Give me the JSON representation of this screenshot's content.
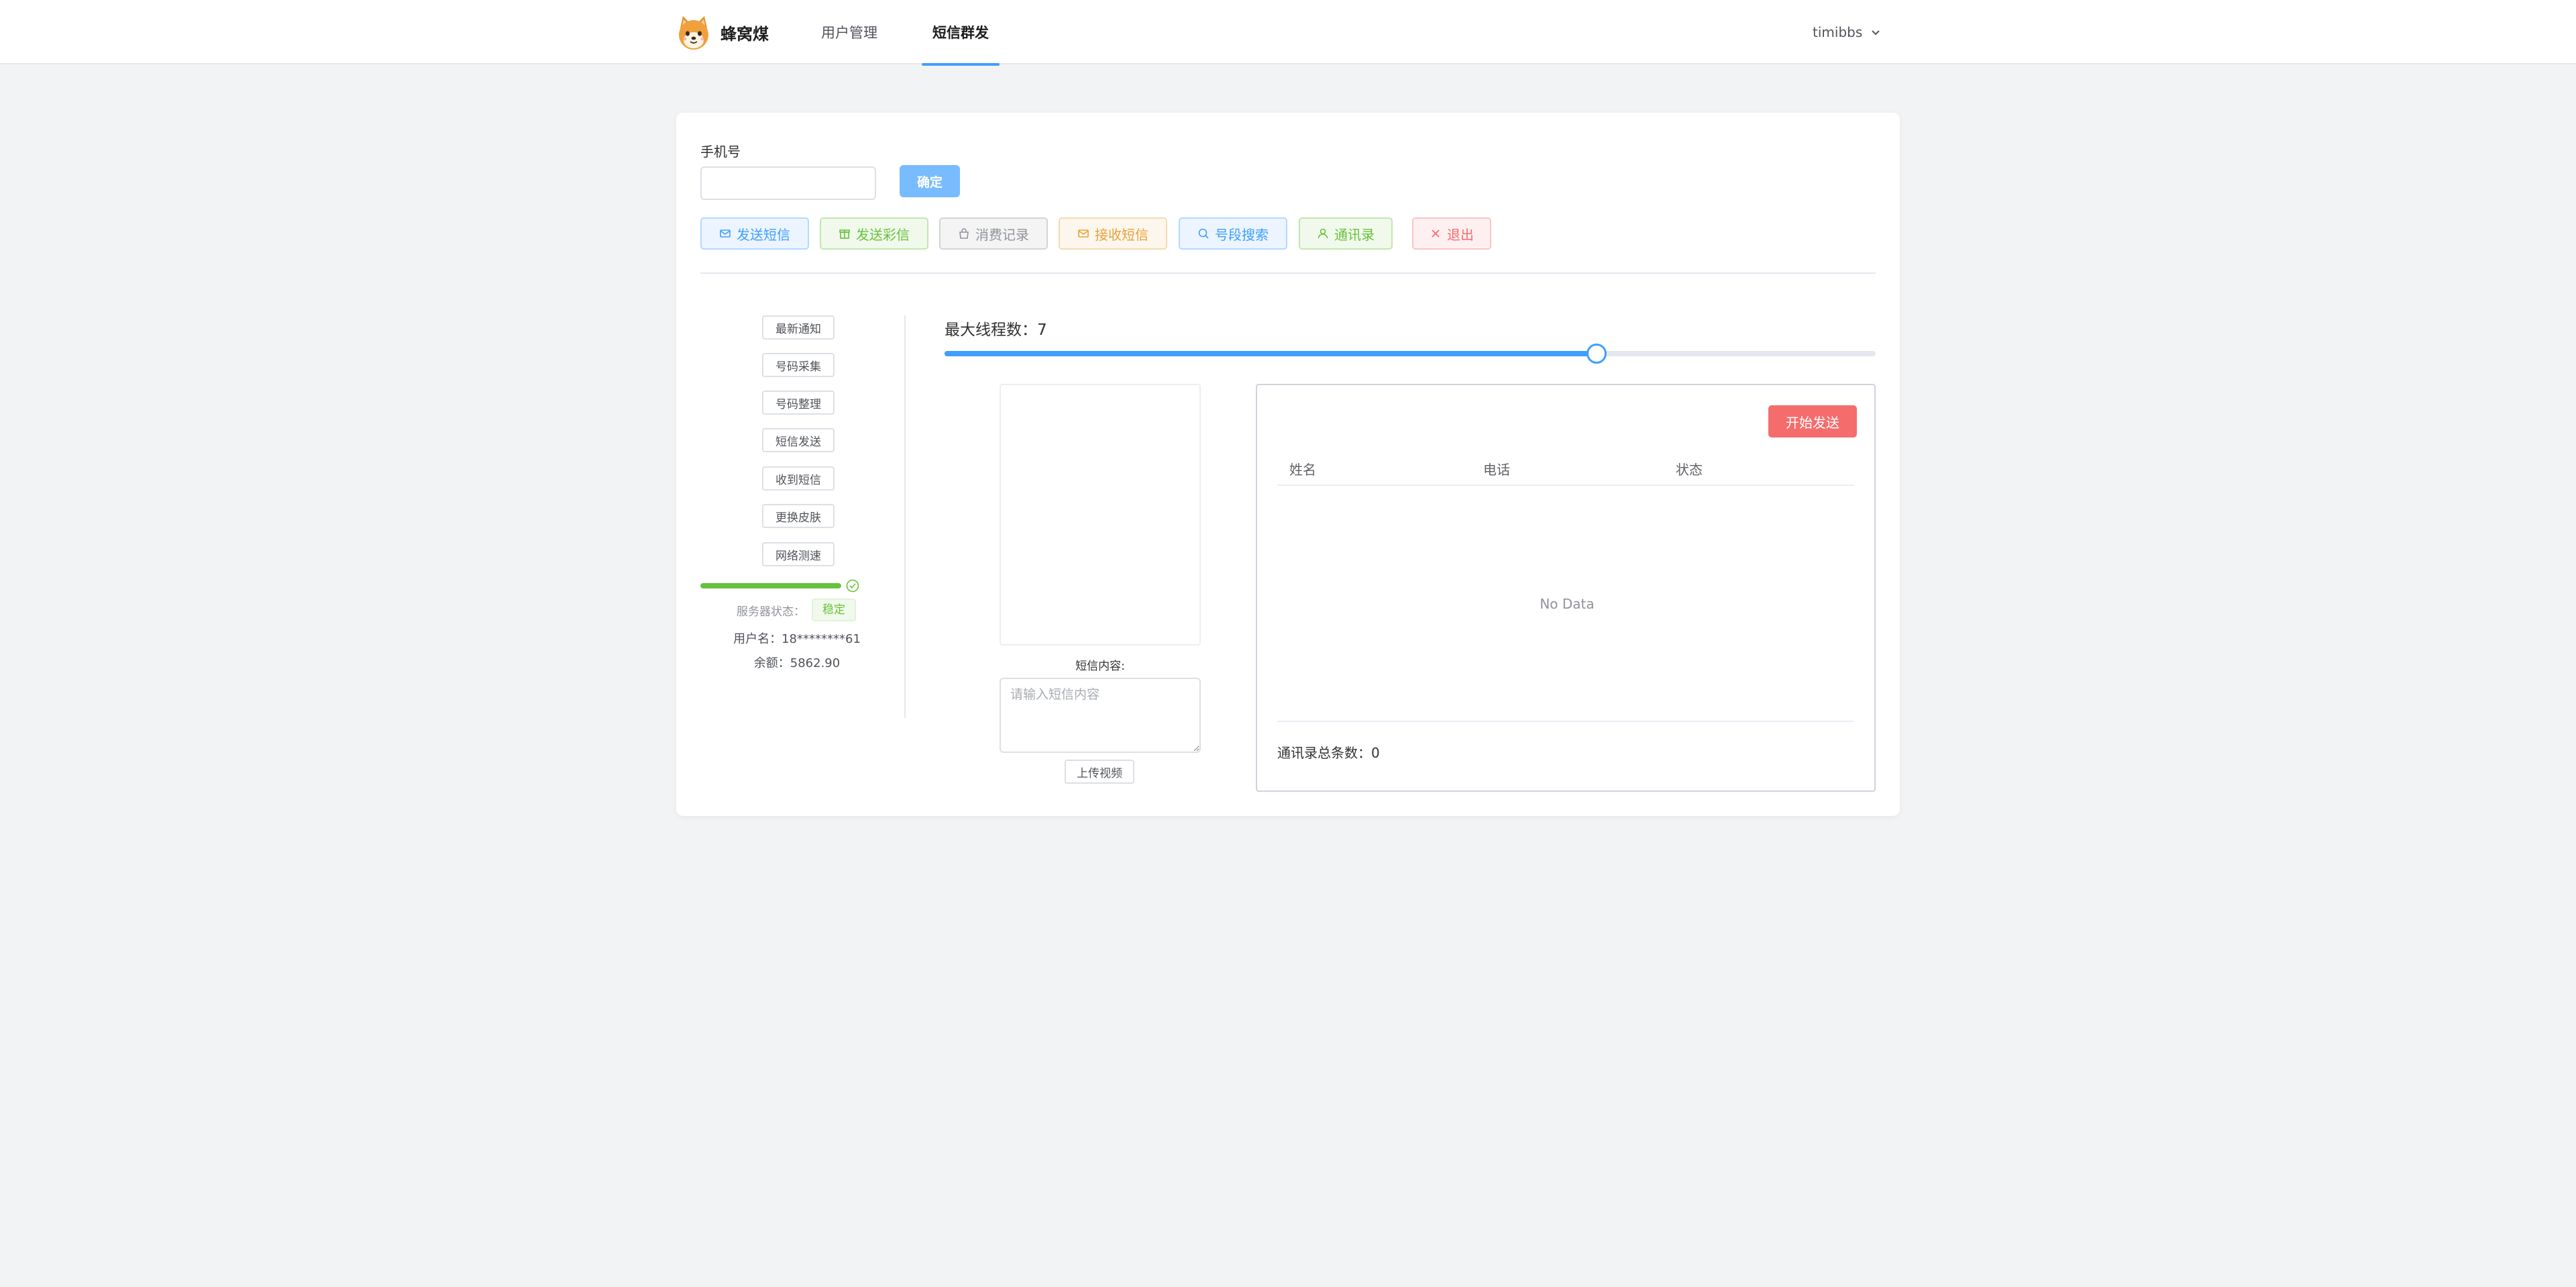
{
  "colors": {
    "primary": "#409eff",
    "success": "#67c23a",
    "danger": "#f56c6c",
    "warning": "#e6a23c",
    "info": "#909399"
  },
  "header": {
    "brand_name": "蜂窝煤",
    "brand_logo_icon": "shiba-dog-logo-icon",
    "nav": [
      {
        "label": "用户管理",
        "active": false
      },
      {
        "label": "短信群发",
        "active": true
      }
    ],
    "user_name": "timibbs"
  },
  "phone_form": {
    "label": "手机号",
    "value": "",
    "placeholder": "",
    "confirm_label": "确定"
  },
  "toolbar": [
    {
      "label": "发送短信",
      "icon": "mail-icon",
      "style": "blue"
    },
    {
      "label": "发送彩信",
      "icon": "gift-icon",
      "style": "green"
    },
    {
      "label": "消费记录",
      "icon": "bag-icon",
      "style": "gray"
    },
    {
      "label": "接收短信",
      "icon": "mail-icon",
      "style": "orange"
    },
    {
      "label": "号段搜索",
      "icon": "search-icon",
      "style": "blue"
    },
    {
      "label": "通讯录",
      "icon": "user-icon",
      "style": "green"
    },
    {
      "label": "退出",
      "icon": "close-icon",
      "style": "red"
    }
  ],
  "side_menu": [
    "最新通知",
    "号码采集",
    "号码整理",
    "短信发送",
    "收到短信",
    "更换皮肤",
    "网络测速"
  ],
  "server": {
    "progress_percent": 100,
    "status_label": "服务器状态：",
    "status_value": "稳定",
    "username_label": "用户名：",
    "username_value": "18********61",
    "balance_label": "余额：",
    "balance_value": "5862.90"
  },
  "threads": {
    "label": "最大线程数：",
    "value": 7,
    "max": 10,
    "fraction": 0.7
  },
  "sms": {
    "content_label": "短信内容:",
    "content_placeholder": "请输入短信内容",
    "content_value": "",
    "upload_label": "上传视频"
  },
  "contacts": {
    "start_label": "开始发送",
    "columns": [
      "姓名",
      "电话",
      "状态"
    ],
    "rows": [],
    "empty_text": "No Data",
    "total_label": "通讯录总条数：",
    "total_value": 0
  }
}
